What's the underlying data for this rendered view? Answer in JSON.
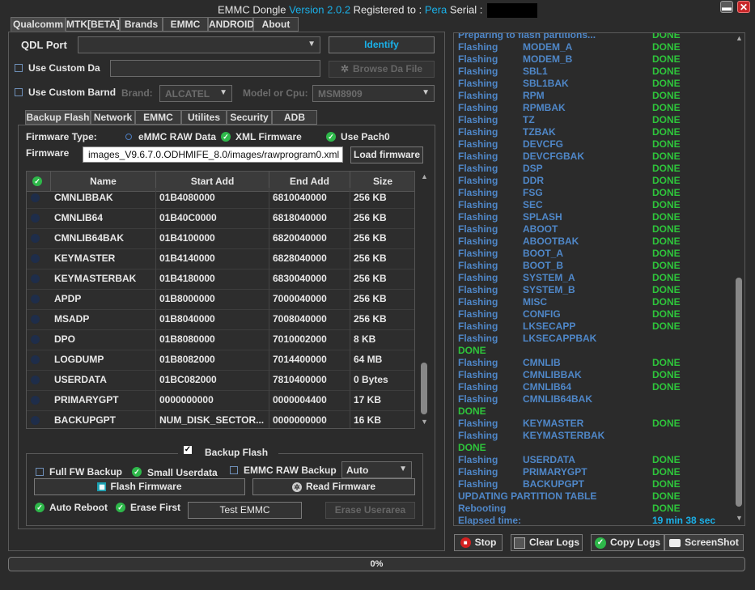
{
  "title": {
    "prefix": "EMMC Dongle ",
    "version": "Version 2.0.2",
    "registered": " Registered to : ",
    "user": "Pera",
    "serial": " Serial : "
  },
  "top_tabs": [
    "Qualcomm",
    "MTK[BETA]",
    "Brands",
    "EMMC",
    "ANDROID",
    "About"
  ],
  "qdl_port": {
    "label": "QDL Port",
    "value": "",
    "identify": "Identify"
  },
  "custom_da": {
    "label": "Use Custom Da",
    "value": "",
    "browse": "Browse Da File"
  },
  "custom_brand": {
    "label": "Use Custom Barnd",
    "brand_label": "Brand:",
    "brand_value": "ALCATEL",
    "model_label": "Model or Cpu:",
    "model_value": "MSM8909"
  },
  "sub_tabs": [
    "Backup  Flash",
    "Network",
    "EMMC",
    "Utilites",
    "Security",
    "ADB"
  ],
  "firmware": {
    "type_label": "Firmware Type:",
    "opt_raw": "eMMC RAW Data",
    "opt_xml": "XML Firmware",
    "opt_patch": "Use Pach0",
    "label": "Firmware",
    "path": "images_V9.6.7.0.ODHMIFE_8.0/images/rawprogram0.xml",
    "load": "Load firmware"
  },
  "table": {
    "headers": [
      "Name",
      "Start Add",
      "End Add",
      "Size"
    ],
    "rows": [
      [
        "CMNLIBBAK",
        "01B4080000",
        "6810040000",
        "256 KB"
      ],
      [
        "CMNLIB64",
        "01B40C0000",
        "6818040000",
        "256 KB"
      ],
      [
        "CMNLIB64BAK",
        "01B4100000",
        "6820040000",
        "256 KB"
      ],
      [
        "KEYMASTER",
        "01B4140000",
        "6828040000",
        "256 KB"
      ],
      [
        "KEYMASTERBAK",
        "01B4180000",
        "6830040000",
        "256 KB"
      ],
      [
        "APDP",
        "01B8000000",
        "7000040000",
        "256 KB"
      ],
      [
        "MSADP",
        "01B8040000",
        "7008040000",
        "256 KB"
      ],
      [
        "DPO",
        "01B8080000",
        "7010002000",
        "8 KB"
      ],
      [
        "LOGDUMP",
        "01B8082000",
        "7014400000",
        "64 MB"
      ],
      [
        "USERDATA",
        "01BC082000",
        "7810400000",
        "0 Bytes"
      ],
      [
        "PRIMARYGPT",
        "0000000000",
        "0000004400",
        "17 KB"
      ],
      [
        "BACKUPGPT",
        "NUM_DISK_SECTOR...",
        "0000000000",
        "16 KB"
      ]
    ]
  },
  "backup_flash": {
    "group_label": "Backup  Flash",
    "full_fw": "Full FW Backup",
    "small_userdata": "Small Userdata",
    "emmc_raw": "EMMC RAW Backup",
    "mode": "Auto",
    "flash": "Flash Firmware",
    "read": "Read Firmware",
    "auto_reboot": "Auto Reboot",
    "erase_first": "Erase First",
    "test_emmc": "Test EMMC",
    "erase_userarea": "Erase Userarea"
  },
  "log": [
    [
      "Preparing to flash partitions...",
      "",
      "DONE"
    ],
    [
      "Flashing",
      "MODEM_A",
      "DONE"
    ],
    [
      "Flashing",
      "MODEM_B",
      "DONE"
    ],
    [
      "Flashing",
      "SBL1",
      "DONE"
    ],
    [
      "Flashing",
      "SBL1BAK",
      "DONE"
    ],
    [
      "Flashing",
      "RPM",
      "DONE"
    ],
    [
      "Flashing",
      "RPMBAK",
      "DONE"
    ],
    [
      "Flashing",
      "TZ",
      "DONE"
    ],
    [
      "Flashing",
      "TZBAK",
      "DONE"
    ],
    [
      "Flashing",
      "DEVCFG",
      "DONE"
    ],
    [
      "Flashing",
      "DEVCFGBAK",
      "DONE"
    ],
    [
      "Flashing",
      "DSP",
      "DONE"
    ],
    [
      "Flashing",
      "DDR",
      "DONE"
    ],
    [
      "Flashing",
      "FSG",
      "DONE"
    ],
    [
      "Flashing",
      "SEC",
      "DONE"
    ],
    [
      "Flashing",
      "SPLASH",
      "DONE"
    ],
    [
      "Flashing",
      "ABOOT",
      "DONE"
    ],
    [
      "Flashing",
      "ABOOTBAK",
      "DONE"
    ],
    [
      "Flashing",
      "BOOT_A",
      "DONE"
    ],
    [
      "Flashing",
      "BOOT_B",
      "DONE"
    ],
    [
      "Flashing",
      "SYSTEM_A",
      "DONE"
    ],
    [
      "Flashing",
      "SYSTEM_B",
      "DONE"
    ],
    [
      "Flashing",
      "MISC",
      "DONE"
    ],
    [
      "Flashing",
      "CONFIG",
      "DONE"
    ],
    [
      "Flashing",
      "LKSECAPP",
      "DONE"
    ],
    [
      "Flashing",
      "LKSECAPPBAK",
      ""
    ],
    [
      "DONE",
      "",
      ""
    ],
    [
      "Flashing",
      "CMNLIB",
      "DONE"
    ],
    [
      "Flashing",
      "CMNLIBBAK",
      "DONE"
    ],
    [
      "Flashing",
      "CMNLIB64",
      "DONE"
    ],
    [
      "Flashing",
      "CMNLIB64BAK",
      ""
    ],
    [
      "DONE",
      "",
      ""
    ],
    [
      "Flashing",
      "KEYMASTER",
      "DONE"
    ],
    [
      "Flashing",
      "KEYMASTERBAK",
      ""
    ],
    [
      "DONE",
      "",
      ""
    ],
    [
      "Flashing",
      "USERDATA",
      "DONE"
    ],
    [
      "Flashing",
      "PRIMARYGPT",
      "DONE"
    ],
    [
      "Flashing",
      "BACKUPGPT",
      "DONE"
    ],
    [
      "UPDATING PARTITION TABLE",
      "",
      "DONE"
    ],
    [
      "Rebooting",
      "",
      "DONE"
    ],
    [
      "Elapsed time:",
      "",
      "19 min  38 sec"
    ]
  ],
  "log_buttons": {
    "stop": "Stop",
    "clear": "Clear Logs",
    "copy": "Copy Logs",
    "screenshot": "ScreenShot"
  },
  "progress": {
    "value": 0,
    "label": "0%"
  },
  "colors": {
    "accent": "#1ab0e8",
    "done": "#2ec43b",
    "log_text": "#4f87c8"
  }
}
